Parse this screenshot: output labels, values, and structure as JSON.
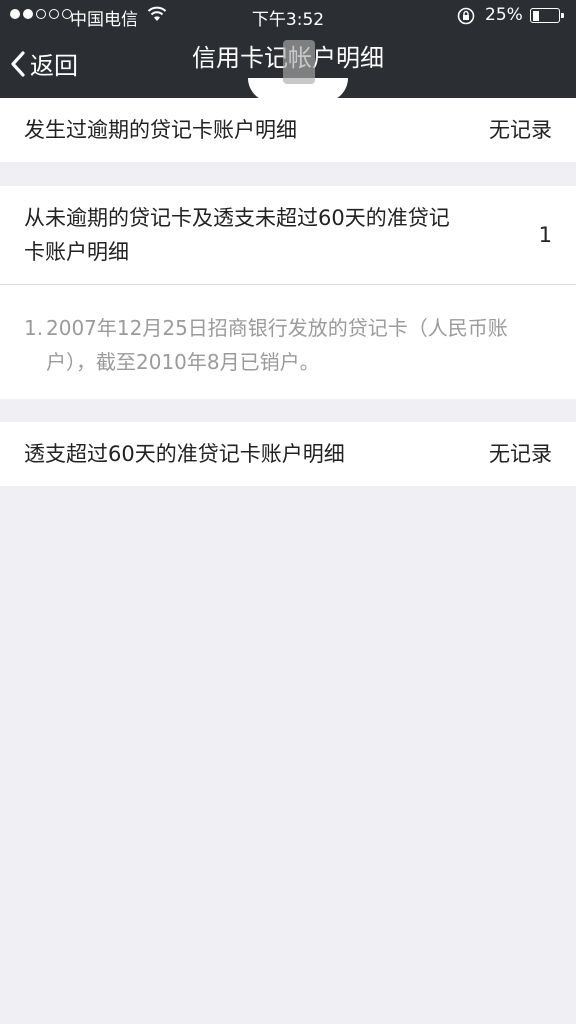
{
  "status_bar": {
    "carrier": "中国电信",
    "time": "下午3:52",
    "battery_percent": "25%",
    "battery_level": 0.25,
    "signal_bars_filled": 2,
    "signal_bars_total": 5
  },
  "nav": {
    "back_label": "返回",
    "title": "信用卡记帐户明细"
  },
  "sections": [
    {
      "label": "发生过逾期的贷记卡账户明细",
      "value": "无记录"
    },
    {
      "label": "从未逾期的贷记卡及透支未超过60天的准贷记卡账户明细",
      "value": "1",
      "details": [
        {
          "index": "1.",
          "text": "2007年12月25日招商银行发放的贷记卡（人民币账户），截至2010年8月已销户。"
        }
      ]
    },
    {
      "label": "透支超过60天的准贷记卡账户明细",
      "value": "无记录"
    }
  ],
  "colors": {
    "nav_background": "#2b2f33",
    "page_background": "#efeff4",
    "detail_text": "#9b9b9b"
  }
}
